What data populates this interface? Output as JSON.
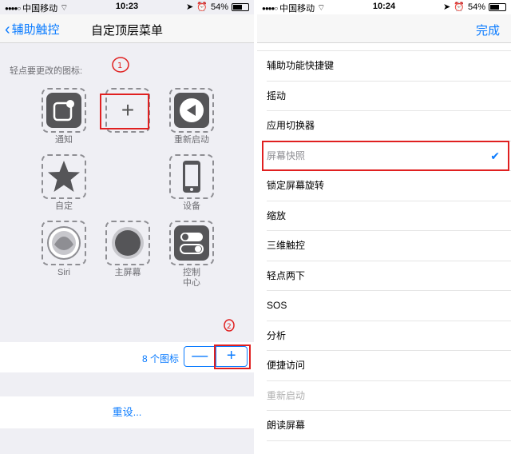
{
  "left": {
    "status": {
      "carrier": "中国移动",
      "time": "10:23",
      "battery": "54%"
    },
    "nav": {
      "back_label": "辅助触控",
      "title": "自定顶层菜单"
    },
    "hint": "轻点要更改的图标:",
    "icons": [
      {
        "label": "通知",
        "icon": "notification-icon"
      },
      {
        "label": "",
        "icon": "plus-icon"
      },
      {
        "label": "重新启动",
        "icon": "restart-icon"
      },
      {
        "label": "自定",
        "icon": "star-icon"
      },
      {
        "label": "设备",
        "icon": "device-icon"
      },
      {
        "label": "Siri",
        "icon": "siri-icon"
      },
      {
        "label": "主屏幕",
        "icon": "home-icon"
      },
      {
        "label": "控制\n中心",
        "icon": "control-center-icon"
      }
    ],
    "count_label": "8 个图标",
    "stepper": {
      "minus": "—",
      "plus": "+"
    },
    "reset_label": "重设..."
  },
  "right": {
    "status": {
      "carrier": "中国移动",
      "time": "10:24",
      "battery": "54%"
    },
    "nav": {
      "done_label": "完成"
    },
    "menu": [
      {
        "label": "辅助功能快捷键",
        "state": "normal"
      },
      {
        "label": "摇动",
        "state": "normal"
      },
      {
        "label": "应用切换器",
        "state": "normal"
      },
      {
        "label": "屏幕快照",
        "state": "selected"
      },
      {
        "label": "锁定屏幕旋转",
        "state": "normal"
      },
      {
        "label": "缩放",
        "state": "normal"
      },
      {
        "label": "三维触控",
        "state": "normal"
      },
      {
        "label": "轻点两下",
        "state": "normal"
      },
      {
        "label": "SOS",
        "state": "normal"
      },
      {
        "label": "分析",
        "state": "normal"
      },
      {
        "label": "便捷访问",
        "state": "normal"
      },
      {
        "label": "重新启动",
        "state": "disabled"
      },
      {
        "label": "朗读屏幕",
        "state": "normal"
      }
    ]
  },
  "colors": {
    "accent": "#0a7bff",
    "highlight": "#e02020",
    "icon_fill": "#555558"
  }
}
